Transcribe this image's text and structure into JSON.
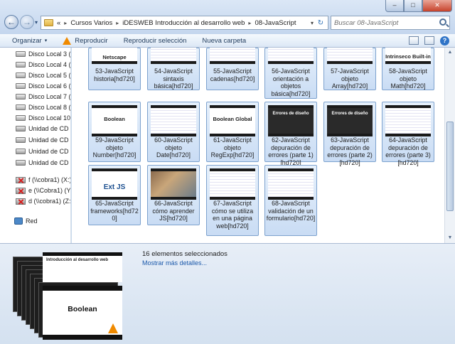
{
  "window": {
    "minimize": "–",
    "maximize": "□",
    "close": "✕"
  },
  "addressbar": {
    "overflow": "«",
    "crumbs": [
      "Cursos Varios",
      "iDESWEB Introducción al desarrollo web",
      "08-JavaScript"
    ]
  },
  "search": {
    "placeholder": "Buscar 08-JavaScript"
  },
  "toolbar": {
    "organize": "Organizar",
    "play": "Reproducir",
    "play_selection": "Reproducir selección",
    "new_folder": "Nueva carpeta"
  },
  "navpane": {
    "items": [
      {
        "label": "Disco Local 3 (E:",
        "icon": "drive"
      },
      {
        "label": "Disco Local 4 (F:",
        "icon": "drive"
      },
      {
        "label": "Disco Local 5 (G:",
        "icon": "drive"
      },
      {
        "label": "Disco Local 6 (H:",
        "icon": "drive"
      },
      {
        "label": "Disco Local 7 (I:",
        "icon": "drive"
      },
      {
        "label": "Disco Local 8 (J:",
        "icon": "drive"
      },
      {
        "label": "Disco Local 10 (",
        "icon": "drive"
      },
      {
        "label": "Unidad de CD (K",
        "icon": "cd"
      },
      {
        "label": "Unidad de CD (L",
        "icon": "cd"
      },
      {
        "label": "Unidad de CD (N",
        "icon": "cd"
      },
      {
        "label": "Unidad de CD (C",
        "icon": "cd"
      },
      {
        "label": "f (\\\\cobra1) (X:)",
        "icon": "netdrive"
      },
      {
        "label": "e (\\\\Cobra1) (Y:",
        "icon": "netdrive"
      },
      {
        "label": "d (\\\\cobra1) (Z:)",
        "icon": "netdrive"
      }
    ],
    "network": "Red"
  },
  "files": [
    {
      "label": "53-JavaScript historia[hd720]",
      "thumb": "Netscape",
      "style": "plain"
    },
    {
      "label": "54-JavaScript sintaxis básica[hd720]",
      "thumb": "",
      "style": "code"
    },
    {
      "label": "55-JavaScript cadenas[hd720]",
      "thumb": "",
      "style": "code"
    },
    {
      "label": "56-JavaScript orientación a objetos básica[hd720]",
      "thumb": "",
      "style": "code"
    },
    {
      "label": "57-JavaScript objeto Array[hd720]",
      "thumb": "",
      "style": "code"
    },
    {
      "label": "58-JavaScript objeto Math[hd720]",
      "thumb": "Intrinseco Built-in",
      "style": "plain"
    },
    {
      "label": "59-JavaScript objeto Number[hd720]",
      "thumb": "Boolean",
      "style": "plain"
    },
    {
      "label": "60-JavaScript objeto Date[hd720]",
      "thumb": "",
      "style": "code"
    },
    {
      "label": "61-JavaScript objeto RegExp[hd720]",
      "thumb": "Boolean Global",
      "style": "plain"
    },
    {
      "label": "62-JavaScript depuración de errores (parte 1)[hd720]",
      "thumb": "Errores de diseño",
      "style": "dark"
    },
    {
      "label": "63-JavaScript depuración de errores (parte 2)[hd720]",
      "thumb": "Errores de diseño",
      "style": "dark"
    },
    {
      "label": "64-JavaScript depuración de errores (parte 3)[hd720]",
      "thumb": "",
      "style": "code"
    },
    {
      "label": "65-JavaScript frameworks[hd720]",
      "thumb": "Ext JS",
      "style": "plain"
    },
    {
      "label": "66-JavaScript cómo aprender JS[hd720]",
      "thumb": "",
      "style": "photo"
    },
    {
      "label": "67-JavaScript cómo se utiliza en una página web[hd720]",
      "thumb": "",
      "style": "code"
    },
    {
      "label": "68-JavaScript validación de un formulario[hd720]",
      "thumb": "",
      "style": "code"
    }
  ],
  "details": {
    "selection_count": "16 elementos seleccionados",
    "more_details": "Mostrar más detalles...",
    "preview_title": "Boolean",
    "preview_top_text": "Introducción al desarrollo web"
  }
}
